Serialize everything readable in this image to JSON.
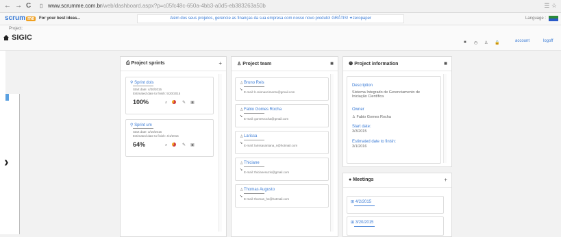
{
  "browser": {
    "back": "←",
    "forward": "→",
    "reload": "C",
    "url_host": "www.scrumme.com.br",
    "url_path": "/web/dashboard.aspx?p=c05fc48c-650a-4bb3-a0d5-eb383263a50b",
    "right_icons": "☰ ☆"
  },
  "app": {
    "logo_text": "scrum",
    "logo_pin": "me",
    "tagline": "For your best ideas...",
    "promo": "Além dos seus projetos, gerencie as finanças da sua empresa com nosso novo produto! GRÁTIS! ✦zeropaper",
    "language_label": "Language :"
  },
  "project": {
    "label": "Project:",
    "name": "SIGIC",
    "toolbar_icons": [
      "■",
      "◷",
      "♙",
      "🔒"
    ],
    "account": "account",
    "logoff": "logoff"
  },
  "columns": {
    "sprints": {
      "title": "Project sprints",
      "action": "+",
      "items": [
        {
          "name": "Sprint dois",
          "start": "Start date: 4/20/2015",
          "finish": "Estimated date to finish: 5/20/2015",
          "progress": "100%"
        },
        {
          "name": "Sprint um",
          "start": "Start date: 3/16/2015",
          "finish": "Estimated date to finish: 4/1/2015",
          "progress": "64%"
        }
      ]
    },
    "team": {
      "title": "Project team",
      "action": "■",
      "members": [
        {
          "name": "Bruno Reis",
          "email": "E-mail: b.reisnascimento@gmail.com"
        },
        {
          "name": "Fabio Gomes Rocha",
          "email": "E-mail: gomesrocha@gmail.com"
        },
        {
          "name": "Larissa",
          "email": "E-mail: larissasantana_n@hotmail.com"
        },
        {
          "name": "Thiciane",
          "email": "E-mail: thicianesuzis@gmail.com"
        },
        {
          "name": "Thomas Augusto",
          "email": "E-mail: thomas_hs@hotmail.com"
        }
      ]
    },
    "info": {
      "title": "Project information",
      "action": "■",
      "description_label": "Description",
      "description": "Sistema Integrado de Gerenciamento de Iniciação Científica",
      "owner_label": "Owner",
      "owner": "Fabio Gomes Rocha",
      "start_label": "Start date:",
      "start": "3/3/2015",
      "finish_label": "Estimated date to finish:",
      "finish": "3/1/2016"
    },
    "meetings": {
      "title": "Meetings",
      "action": "+",
      "items": [
        {
          "date": "4/2/2015"
        },
        {
          "date": "3/20/2015"
        }
      ]
    }
  },
  "colors": {
    "accent": "#3a7bd5",
    "promo_text": "#3a7bd5",
    "logo_pin": "#f0a020"
  }
}
